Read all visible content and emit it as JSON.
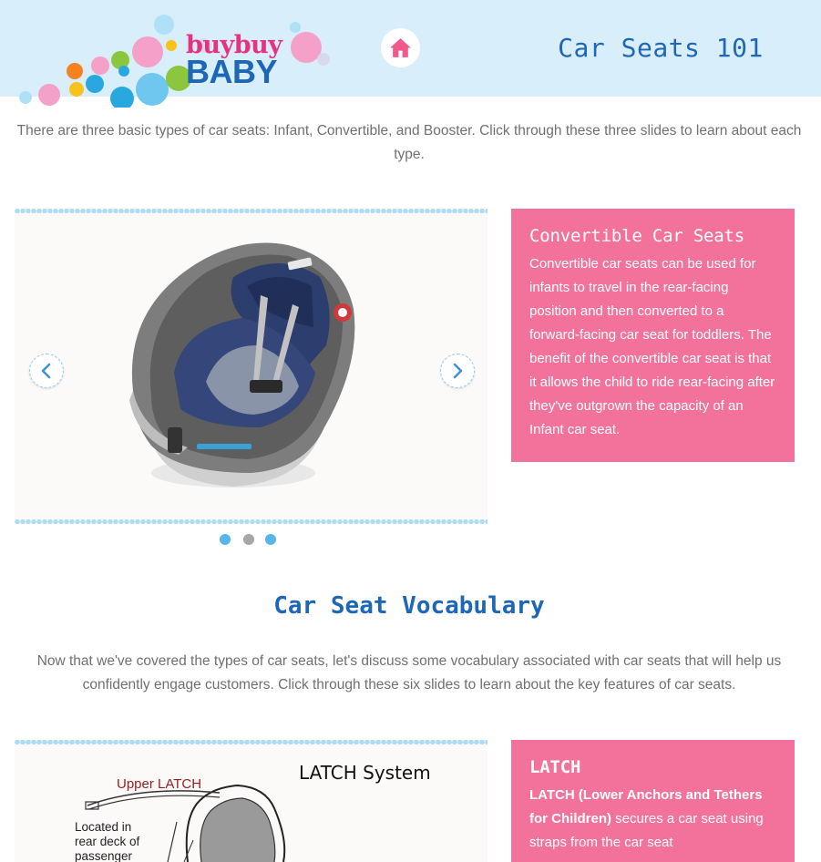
{
  "header": {
    "brand_line1": "buybuy",
    "brand_line2": "BABY",
    "page_title": "Car Seats 101",
    "home_icon": "home-icon",
    "colors": {
      "header_bg": "#d8eefb",
      "title": "#1d67b6",
      "brand_pink": "#e6337f"
    }
  },
  "intro": {
    "text": "There are three basic types of car seats: Infant, Convertible, and Booster. Click through these three slides to learn about each type."
  },
  "slider1": {
    "image": "convertible-car-seat-photo",
    "prev_icon": "chevron-left-icon",
    "next_icon": "chevron-right-icon",
    "dots": [
      {
        "state": "blue"
      },
      {
        "state": "gray"
      },
      {
        "state": "blue"
      }
    ],
    "info_title": "Convertible Car Seats",
    "info_body": "Convertible car seats can be used for infants to travel in the rear-facing position and then converted to a forward-facing car seat for toddlers. The benefit of the convertible car seat is that it allows the child to ride rear-facing after they've outgrown the capacity of an Infant car seat."
  },
  "vocab": {
    "title": "Car Seat Vocabulary",
    "intro": "Now that we've covered the types of car seats, let's discuss some vocabulary associated with car seats that will help us confidently engage customers. Click through these six slides to learn about the key features of car seats."
  },
  "slider2": {
    "image": "latch-system-diagram",
    "diagram_title": "LATCH System",
    "upper_label": "Upper LATCH",
    "located_lines": [
      "Located in",
      "rear deck of",
      "passenger"
    ],
    "info_title": "LATCH",
    "info_bold": "LATCH (Lower Anchors and Tethers for Children)",
    "info_rest": " secures a car seat using straps from the car seat"
  },
  "colors": {
    "pink_panel": "#f2729b",
    "accent_blue": "#56b6ec"
  }
}
